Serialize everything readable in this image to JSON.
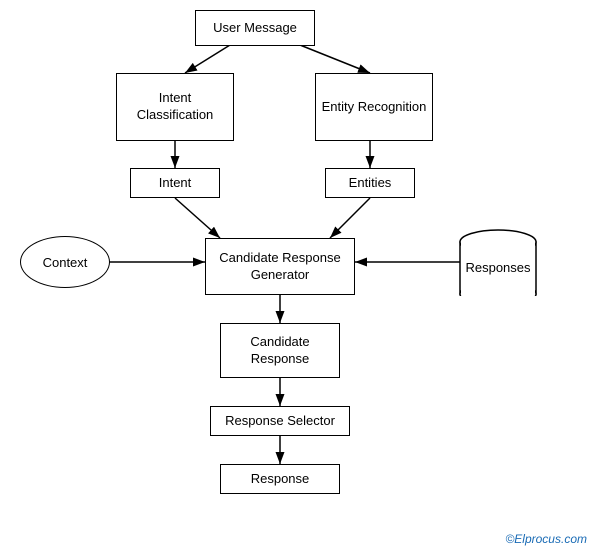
{
  "nodes": {
    "user_message": {
      "label": "User Message"
    },
    "intent_classification": {
      "label": "Intent\nClassification"
    },
    "entity_recognition": {
      "label": "Entity Recognition"
    },
    "intent": {
      "label": "Intent"
    },
    "entities": {
      "label": "Entities"
    },
    "context": {
      "label": "Context"
    },
    "candidate_response_generator": {
      "label": "Candidate Response\nGenerator"
    },
    "responses": {
      "label": "Responses"
    },
    "candidate_response": {
      "label": "Candidate\nResponse"
    },
    "response_selector": {
      "label": "Response Selector"
    },
    "response": {
      "label": "Response"
    }
  },
  "watermark": "©Elprocus.com"
}
